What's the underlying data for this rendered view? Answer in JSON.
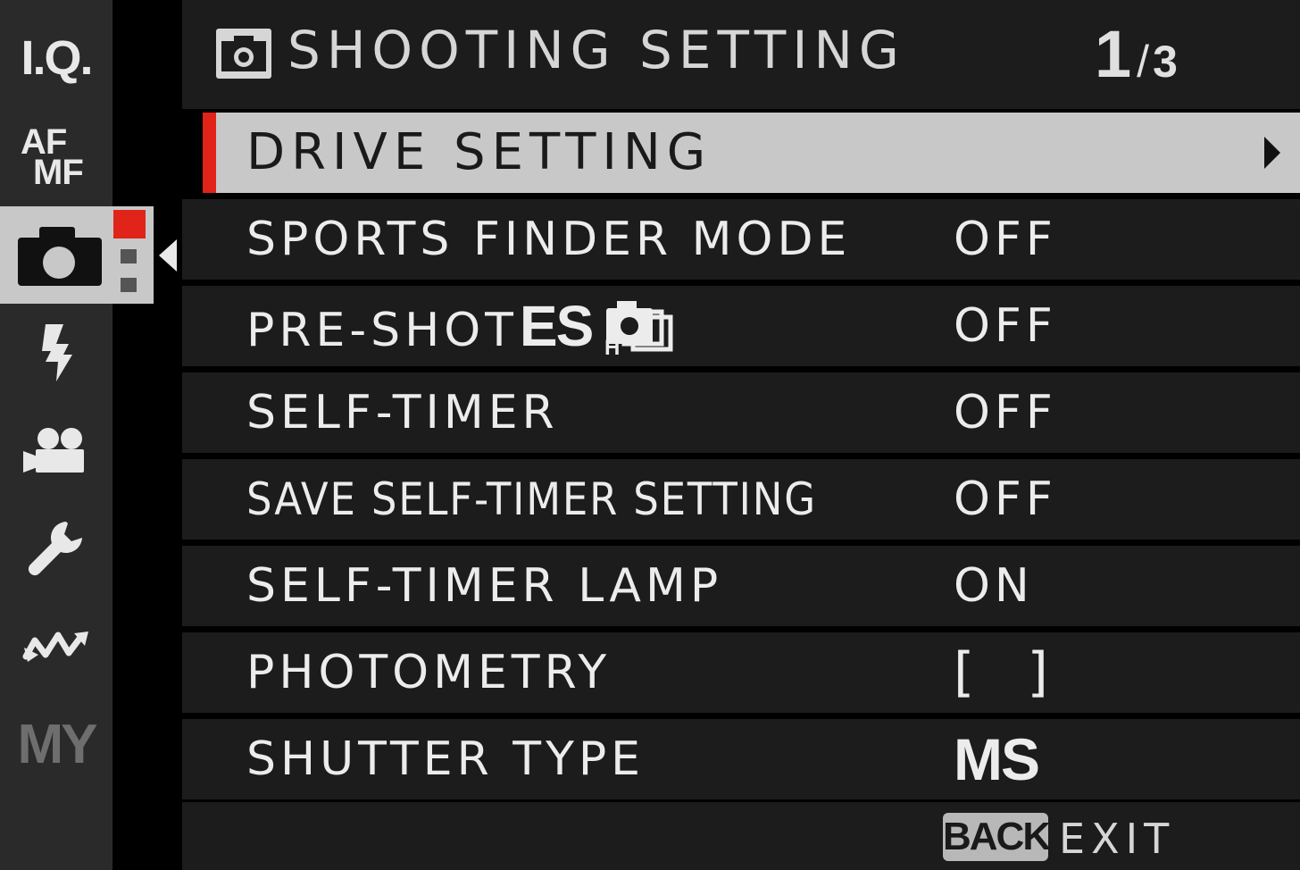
{
  "sidebar": {
    "tabs": [
      {
        "id": "iq",
        "label": "I.Q."
      },
      {
        "id": "af-mf",
        "label_top": "AF",
        "label_bottom": "MF"
      },
      {
        "id": "shooting-setting",
        "icon": "camera-icon",
        "active": true
      },
      {
        "id": "flash",
        "icon": "flash-icon"
      },
      {
        "id": "movie",
        "icon": "movie-camera-icon"
      },
      {
        "id": "setup",
        "icon": "wrench-icon"
      },
      {
        "id": "connection",
        "icon": "connection-icon"
      },
      {
        "id": "my-menu",
        "label": "MY"
      }
    ]
  },
  "header": {
    "icon": "camera-icon",
    "title": "SHOOTING SETTING",
    "page_current": "1",
    "page_separator": "/",
    "page_total": "3"
  },
  "menu": {
    "items": [
      {
        "label": "DRIVE SETTING",
        "value": "",
        "selected": true,
        "has_submenu": true
      },
      {
        "label": "SPORTS FINDER MODE",
        "value": "OFF"
      },
      {
        "label": "PRE-SHOT",
        "label_suffix": "ES",
        "label_icon": "high-speed-burst-icon",
        "value": "OFF"
      },
      {
        "label": "SELF-TIMER",
        "value": "OFF"
      },
      {
        "label": "SAVE SELF-TIMER SETTING",
        "value": "OFF"
      },
      {
        "label": "SELF-TIMER LAMP",
        "value": "ON"
      },
      {
        "label": "PHOTOMETRY",
        "value": "[ ]"
      },
      {
        "label": "SHUTTER TYPE",
        "value": "MS"
      }
    ]
  },
  "footer": {
    "back_label": "BACK",
    "exit_label": "EXIT"
  },
  "colors": {
    "accent_red": "#e0241a",
    "selected_row_bg": "#c8c8c8",
    "row_bg": "#1c1c1c",
    "sidebar_bg": "#2a2a2a",
    "text": "#ececec"
  }
}
